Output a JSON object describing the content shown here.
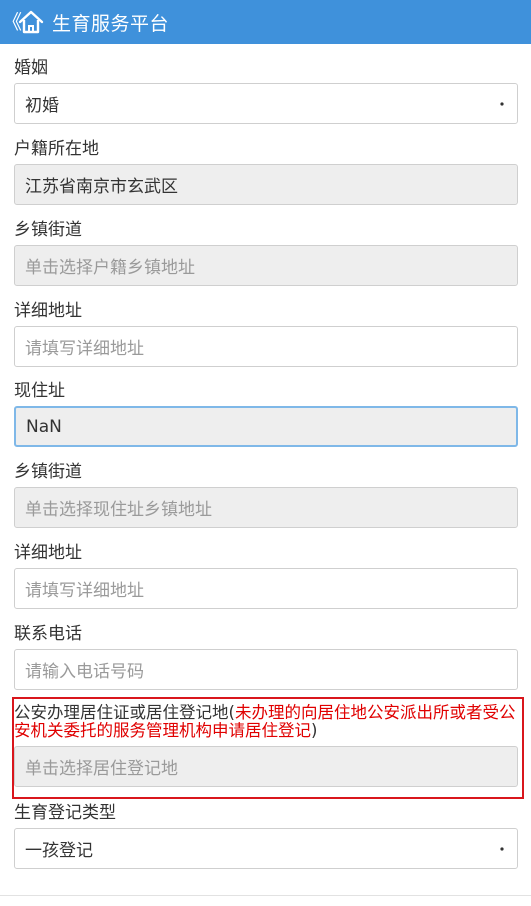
{
  "header": {
    "title": "生育服务平台",
    "back_glyph": "《"
  },
  "fields": {
    "marriage": {
      "label": "婚姻",
      "value": "初婚"
    },
    "household": {
      "label": "户籍所在地",
      "value": "江苏省南京市玄武区"
    },
    "household_town": {
      "label": "乡镇街道",
      "placeholder": "单击选择户籍乡镇地址"
    },
    "household_detail": {
      "label": "详细地址",
      "placeholder": "请填写详细地址"
    },
    "current": {
      "label": "现住址",
      "value": "NaN"
    },
    "current_town": {
      "label": "乡镇街道",
      "placeholder": "单击选择现住址乡镇地址"
    },
    "current_detail": {
      "label": "详细地址",
      "placeholder": "请填写详细地址"
    },
    "phone": {
      "label": "联系电话",
      "placeholder": "请输入电话号码"
    },
    "residence_reg": {
      "label_prefix": "公安办理居住证或居住登记地(",
      "label_warning": "未办理的向居住地公安派出所或者受公安机关委托的服务管理机构申请居住登记",
      "label_suffix": ")",
      "placeholder": "单击选择居住登记地"
    },
    "birth_type": {
      "label": "生育登记类型",
      "value": "一孩登记"
    }
  },
  "colors": {
    "header": "#3f91db",
    "warning": "#e00000",
    "frame": "#d9161c"
  }
}
